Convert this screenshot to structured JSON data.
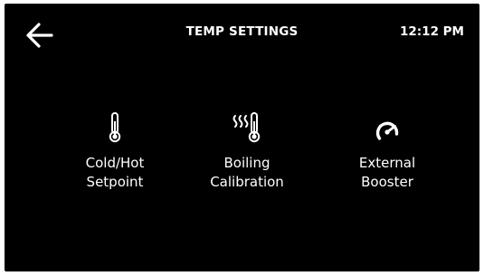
{
  "header": {
    "back_icon": "arrow-left-icon",
    "title": "TEMP SETTINGS",
    "time": "12:12 PM"
  },
  "menu": {
    "items": [
      {
        "icon": "thermometer-icon",
        "line1": "Cold/Hot",
        "line2": "Setpoint"
      },
      {
        "icon": "heat-thermometer-icon",
        "line1": "Boiling",
        "line2": "Calibration"
      },
      {
        "icon": "gauge-icon",
        "line1": "External",
        "line2": "Booster"
      }
    ]
  },
  "colors": {
    "background": "#000000",
    "foreground": "#ffffff"
  }
}
